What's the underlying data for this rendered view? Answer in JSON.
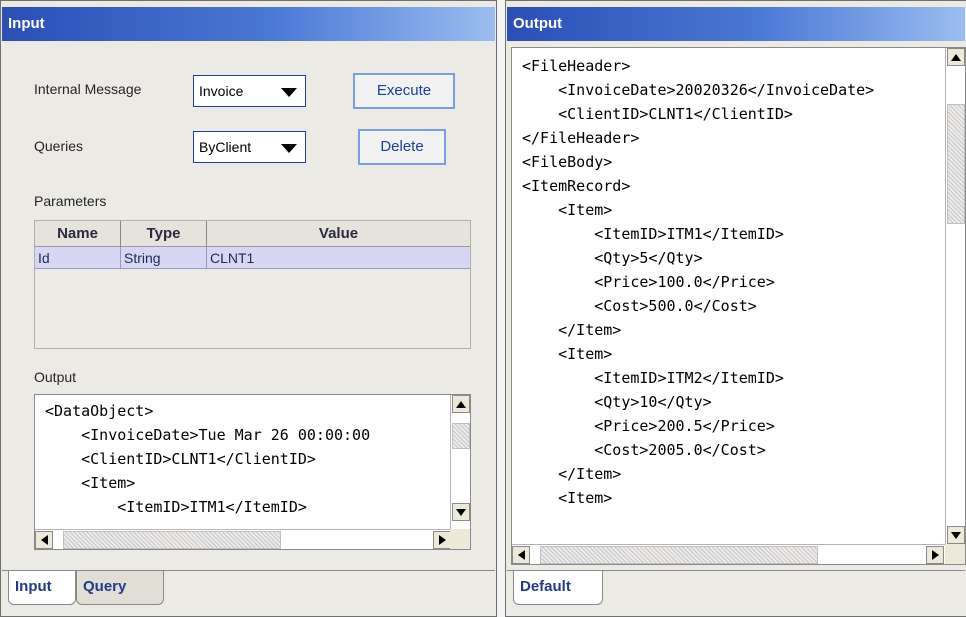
{
  "left_panel": {
    "title": "Input",
    "internal_message": {
      "label": "Internal Message",
      "selected": "Invoice"
    },
    "execute_label": "Execute",
    "queries": {
      "label": "Queries",
      "selected": "ByClient"
    },
    "delete_label": "Delete",
    "parameters": {
      "label": "Parameters",
      "columns": [
        "Name",
        "Type",
        "Value"
      ],
      "rows": [
        {
          "name": "Id",
          "type": "String",
          "value": "CLNT1"
        }
      ]
    },
    "output": {
      "label": "Output",
      "lines": [
        "<DataObject>",
        "    <InvoiceDate>Tue Mar 26 00:00:00",
        "    <ClientID>CLNT1</ClientID>",
        "    <Item>",
        "        <ItemID>ITM1</ItemID>"
      ]
    },
    "tabs": [
      "Input",
      "Query"
    ],
    "active_tab": "Input"
  },
  "right_panel": {
    "title": "Output",
    "lines": [
      "<FileHeader>",
      "    <InvoiceDate>20020326</InvoiceDate>",
      "    <ClientID>CLNT1</ClientID>",
      "</FileHeader>",
      "<FileBody>",
      "<ItemRecord>",
      "    <Item>",
      "        <ItemID>ITM1</ItemID>",
      "        <Qty>5</Qty>",
      "        <Price>100.0</Price>",
      "        <Cost>500.0</Cost>",
      "    </Item>",
      "    <Item>",
      "        <ItemID>ITM2</ItemID>",
      "        <Qty>10</Qty>",
      "        <Price>200.5</Price>",
      "        <Cost>2005.0</Cost>",
      "    </Item>",
      "    <Item>"
    ],
    "tabs": [
      "Default"
    ],
    "active_tab": "Default"
  },
  "colors": {
    "title_gradient_start": "#2a4fb5",
    "title_gradient_end": "#9bbdf0",
    "panel_bg": "#eceae5",
    "selected_row": "#d7d7f4",
    "button_text": "#163ea4"
  }
}
